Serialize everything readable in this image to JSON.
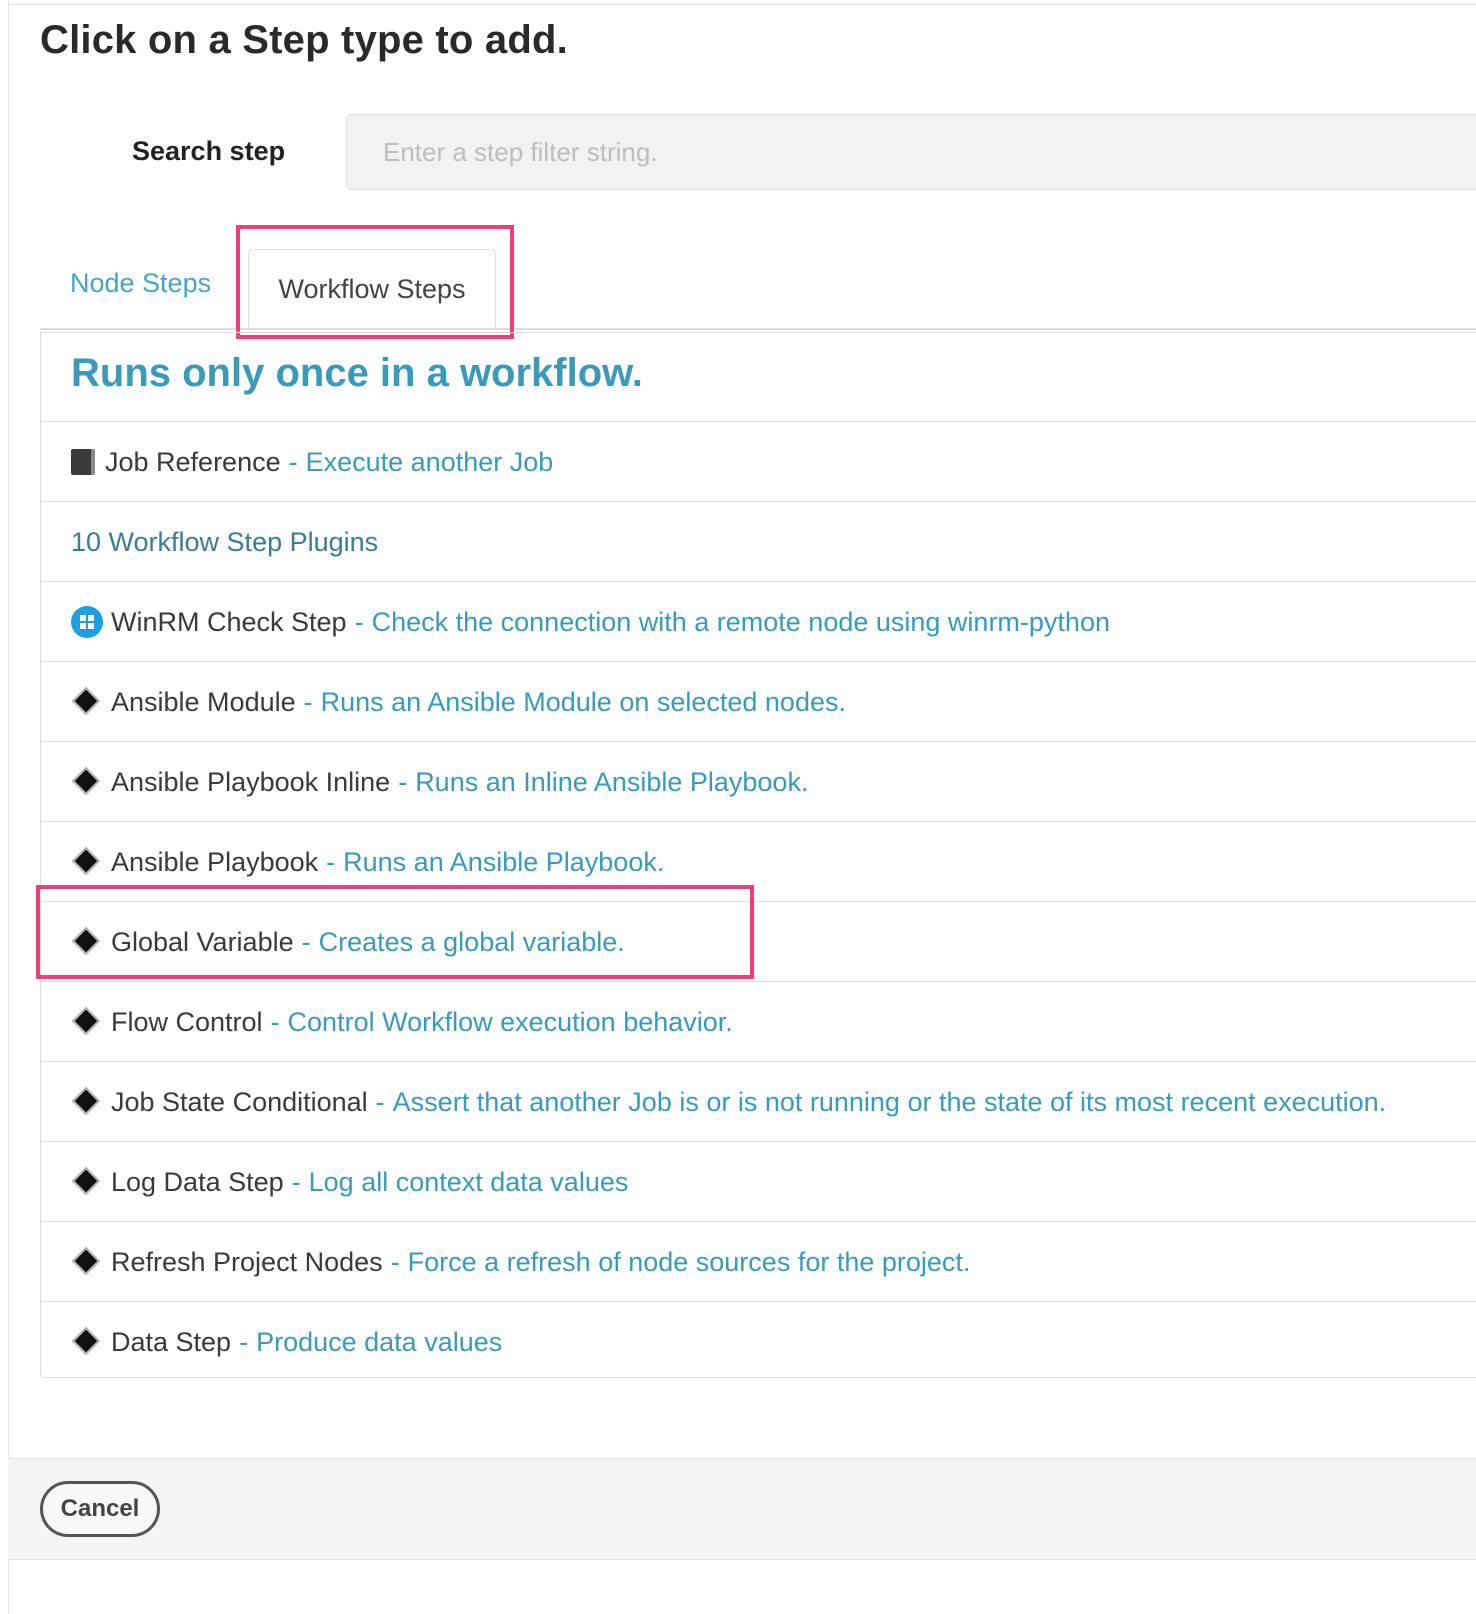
{
  "title": "Click on a Step type to add.",
  "search": {
    "label": "Search step",
    "placeholder": "Enter a step filter string.",
    "value": ""
  },
  "tabs": {
    "node": "Node Steps",
    "workflow": "Workflow Steps",
    "active": "Workflow Steps"
  },
  "panel": {
    "heading": "Runs only once in a workflow.",
    "job_reference": {
      "name": "Job Reference",
      "separator": "-",
      "desc": "Execute another Job",
      "icon": "book-icon"
    },
    "plugins_count": "10 Workflow Step Plugins",
    "steps": [
      {
        "name": "WinRM Check Step",
        "desc": "Check the connection with a remote node using winrm-python",
        "icon": "windows-icon"
      },
      {
        "name": "Ansible Module",
        "desc": "Runs an Ansible Module on selected nodes.",
        "icon": "diamond-icon"
      },
      {
        "name": "Ansible Playbook Inline",
        "desc": "Runs an Inline Ansible Playbook.",
        "icon": "diamond-icon"
      },
      {
        "name": "Ansible Playbook",
        "desc": "Runs an Ansible Playbook.",
        "icon": "diamond-icon"
      },
      {
        "name": "Global Variable",
        "desc": "Creates a global variable.",
        "icon": "diamond-icon"
      },
      {
        "name": "Flow Control",
        "desc": "Control Workflow execution behavior.",
        "icon": "diamond-icon"
      },
      {
        "name": "Job State Conditional",
        "desc": "Assert that another Job is or is not running or the state of its most recent execution.",
        "icon": "diamond-icon"
      },
      {
        "name": "Log Data Step",
        "desc": "Log all context data values",
        "icon": "diamond-icon"
      },
      {
        "name": "Refresh Project Nodes",
        "desc": "Force a refresh of node sources for the project.",
        "icon": "diamond-icon"
      },
      {
        "name": "Data Step",
        "desc": "Produce data values",
        "icon": "diamond-icon"
      }
    ]
  },
  "footer": {
    "cancel_label": "Cancel"
  },
  "colors": {
    "link": "#3a9ab8",
    "highlight": "#ef3e78",
    "windows_blue": "#1ba1e2"
  }
}
